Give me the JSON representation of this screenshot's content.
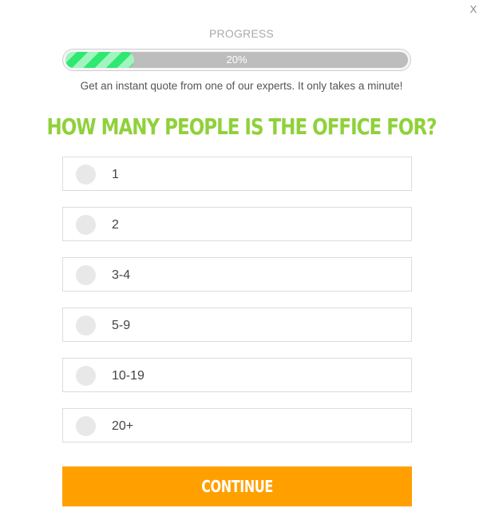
{
  "close": {
    "label": "X"
  },
  "progress": {
    "label": "PROGRESS",
    "percent": 20,
    "percent_text": "20%"
  },
  "subtitle": "Get an instant quote from one of our experts. It only takes a minute!",
  "question": "HOW MANY PEOPLE IS THE OFFICE FOR?",
  "options": [
    {
      "label": "1",
      "selected": false
    },
    {
      "label": "2",
      "selected": false
    },
    {
      "label": "3-4",
      "selected": false
    },
    {
      "label": "5-9",
      "selected": false
    },
    {
      "label": "10-19",
      "selected": false
    },
    {
      "label": "20+",
      "selected": false
    }
  ],
  "continue_label": "CONTINUE",
  "colors": {
    "accent_green": "#8fd13a",
    "progress_green": "#2fe872",
    "button_orange": "#ffa000"
  }
}
